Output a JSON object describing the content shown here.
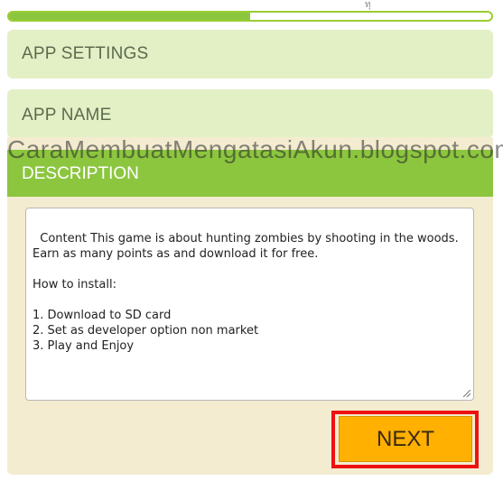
{
  "progress": {
    "value_percent": 50
  },
  "corner_mark": "ทุ",
  "sections": {
    "settings_label": "APP SETTINGS",
    "app_name_label": "APP NAME",
    "description_label": "DESCRIPTION"
  },
  "description_text": "Content This game is about hunting zombies by shooting in the woods. Earn as many points as and download it for free.\n\nHow to install:\n\n1. Download to SD card\n2. Set as developer option non market\n3. Play and Enjoy",
  "watermark": "CaraMembuatMengatasiAkun.blogspot.com",
  "next_button_label": "NEXT",
  "colors": {
    "accent_green": "#8cc63f",
    "light_green_panel": "#e3f0c5",
    "cream_panel": "#f3ecd0",
    "next_button": "#ffb000",
    "highlight_red": "#ee1111"
  }
}
